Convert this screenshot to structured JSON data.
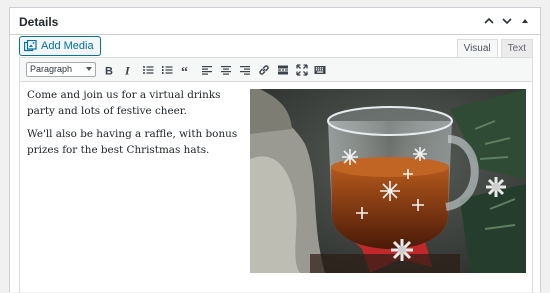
{
  "panel": {
    "title": "Details",
    "controls": [
      "chevron-up",
      "chevron-down",
      "triangle-up"
    ]
  },
  "media": {
    "add_label": "Add Media"
  },
  "tabs": {
    "visual": "Visual",
    "text": "Text"
  },
  "toolbar": {
    "format_value": "Paragraph",
    "buttons": [
      "bold",
      "italic",
      "bulleted-list",
      "numbered-list",
      "blockquote",
      "align-left",
      "align-center",
      "align-right",
      "insert-link",
      "read-more",
      "fullscreen",
      "toolbar-toggle"
    ]
  },
  "content": {
    "paragraphs": [
      "Come and join us for a virtual drinks party and lots of festive cheer.",
      "We'll also be having a raffle, with bonus prizes for the best Christmas hats."
    ],
    "image": "festive-tea-glass-photo"
  },
  "colors": {
    "accent": "#0071a1",
    "border": "#ccd0d4"
  }
}
